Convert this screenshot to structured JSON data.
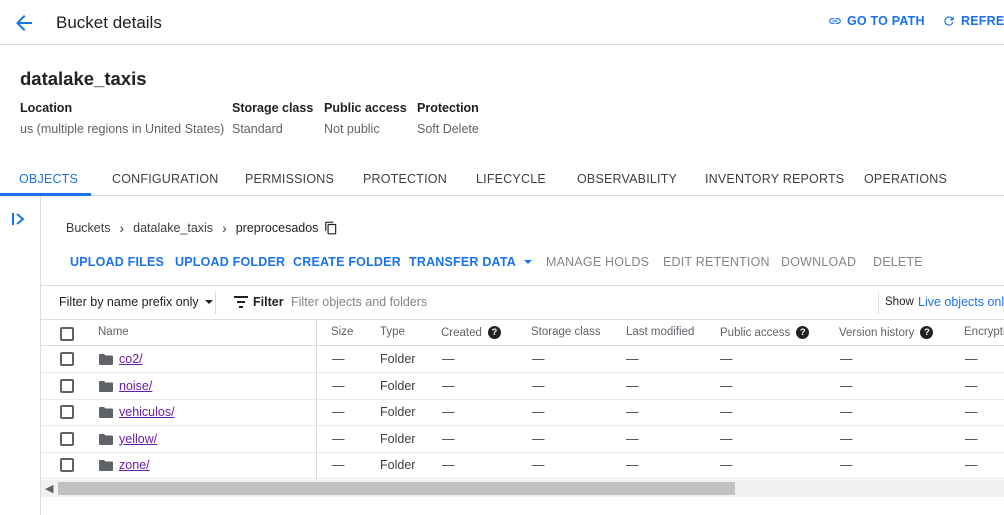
{
  "header": {
    "title": "Bucket details",
    "go_to_path": "GO TO PATH",
    "refresh": "REFRESH"
  },
  "bucket": {
    "name": "datalake_taxis",
    "location_label": "Location",
    "location_value": "us (multiple regions in United States)",
    "storage_class_label": "Storage class",
    "storage_class_value": "Standard",
    "public_access_label": "Public access",
    "public_access_value": "Not public",
    "protection_label": "Protection",
    "protection_value": "Soft Delete"
  },
  "tabs": [
    {
      "label": "OBJECTS",
      "active": true
    },
    {
      "label": "CONFIGURATION"
    },
    {
      "label": "PERMISSIONS"
    },
    {
      "label": "PROTECTION"
    },
    {
      "label": "LIFECYCLE"
    },
    {
      "label": "OBSERVABILITY"
    },
    {
      "label": "INVENTORY REPORTS"
    },
    {
      "label": "OPERATIONS"
    }
  ],
  "breadcrumb": {
    "items": [
      "Buckets",
      "datalake_taxis"
    ],
    "current": "preprocesados"
  },
  "actions": {
    "upload_files": "UPLOAD FILES",
    "upload_folder": "UPLOAD FOLDER",
    "create_folder": "CREATE FOLDER",
    "transfer_data": "TRANSFER DATA",
    "manage_holds": "MANAGE HOLDS",
    "edit_retention": "EDIT RETENTION",
    "download": "DOWNLOAD",
    "delete": "DELETE"
  },
  "filter": {
    "prefix_dropdown": "Filter by name prefix only",
    "label": "Filter",
    "placeholder": "Filter objects and folders",
    "show_label": "Show",
    "show_value": "Live objects only"
  },
  "table": {
    "columns": {
      "name": "Name",
      "size": "Size",
      "type": "Type",
      "created": "Created",
      "storage_class": "Storage class",
      "last_modified": "Last modified",
      "public_access": "Public access",
      "version_history": "Version history",
      "encryption": "Encryption"
    },
    "rows": [
      {
        "name": "co2/",
        "size": "—",
        "type": "Folder",
        "created": "—",
        "storage_class": "—",
        "last_modified": "—",
        "public_access": "—",
        "version_history": "—",
        "encryption": "—"
      },
      {
        "name": "noise/",
        "size": "—",
        "type": "Folder",
        "created": "—",
        "storage_class": "—",
        "last_modified": "—",
        "public_access": "—",
        "version_history": "—",
        "encryption": "—"
      },
      {
        "name": "vehiculos/",
        "size": "—",
        "type": "Folder",
        "created": "—",
        "storage_class": "—",
        "last_modified": "—",
        "public_access": "—",
        "version_history": "—",
        "encryption": "—"
      },
      {
        "name": "yellow/",
        "size": "—",
        "type": "Folder",
        "created": "—",
        "storage_class": "—",
        "last_modified": "—",
        "public_access": "—",
        "version_history": "—",
        "encryption": "—"
      },
      {
        "name": "zone/",
        "size": "—",
        "type": "Folder",
        "created": "—",
        "storage_class": "—",
        "last_modified": "—",
        "public_access": "—",
        "version_history": "—",
        "encryption": "—"
      }
    ]
  },
  "icons": {
    "back": "arrow-back-icon",
    "link": "link-icon",
    "refresh": "refresh-icon",
    "rail": "expand-panel-icon",
    "copy": "copy-icon",
    "filter": "filter-icon",
    "folder": "folder-icon",
    "help": "help-icon"
  },
  "colors": {
    "accent": "#1a73e8",
    "link_visited": "#681da8",
    "text": "#202124",
    "muted": "#5f6368"
  }
}
